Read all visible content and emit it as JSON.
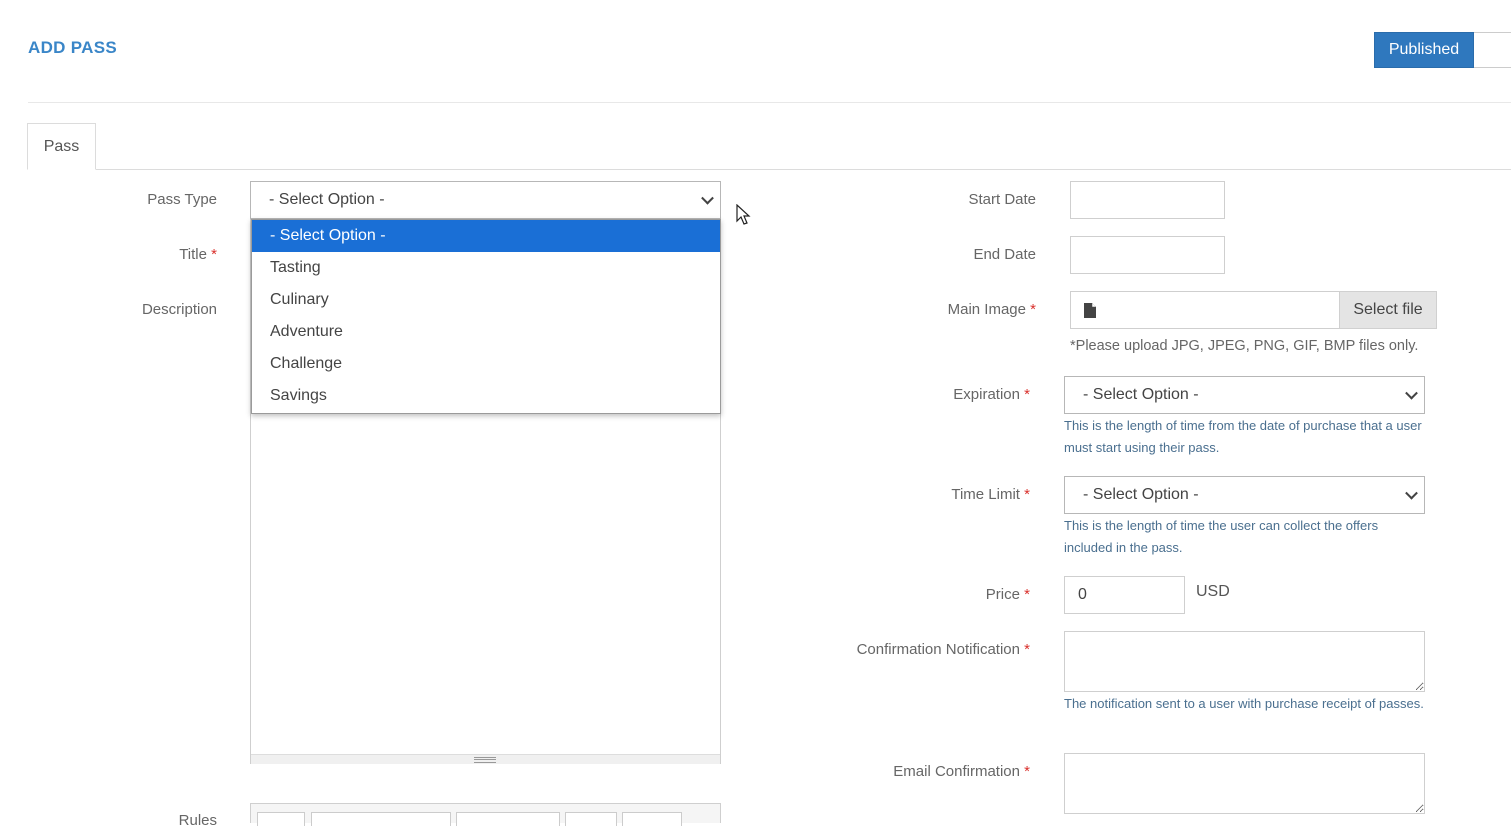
{
  "header": {
    "title": "ADD PASS",
    "status_label": "Published"
  },
  "tabs": [
    {
      "label": "Pass"
    }
  ],
  "left_form": {
    "pass_type": {
      "label": "Pass Type",
      "value": "- Select Option -",
      "options": [
        "- Select Option -",
        "Tasting",
        "Culinary",
        "Adventure",
        "Challenge",
        "Savings"
      ]
    },
    "title": {
      "label": "Title",
      "required": "*"
    },
    "description": {
      "label": "Description"
    },
    "rules": {
      "label": "Rules"
    }
  },
  "right_form": {
    "start_date": {
      "label": "Start Date",
      "value": ""
    },
    "end_date": {
      "label": "End Date",
      "value": ""
    },
    "main_image": {
      "label": "Main Image",
      "required": "*",
      "button": "Select file",
      "help": "*Please upload JPG, JPEG, PNG, GIF, BMP files only."
    },
    "expiration": {
      "label": "Expiration",
      "required": "*",
      "value": "- Select Option -",
      "help": "This is the length of time from the date of purchase that a user must start using their pass."
    },
    "time_limit": {
      "label": "Time Limit",
      "required": "*",
      "value": "- Select Option -",
      "help": "This is the length of time the user can collect the offers included in the pass."
    },
    "price": {
      "label": "Price",
      "required": "*",
      "value": "0",
      "currency": "USD"
    },
    "confirmation_notification": {
      "label": "Confirmation Notification",
      "required": "*",
      "help": "The notification sent to a user with purchase receipt of passes."
    },
    "email_confirmation": {
      "label": "Email Confirmation",
      "required": "*"
    }
  },
  "colors": {
    "accent": "#3a86c8",
    "button": "#2f78be",
    "selected_option": "#1a6fd6",
    "required": "#d9302c"
  },
  "icons": [
    "file-icon",
    "chevron-down-icon",
    "mouse-cursor-icon"
  ]
}
